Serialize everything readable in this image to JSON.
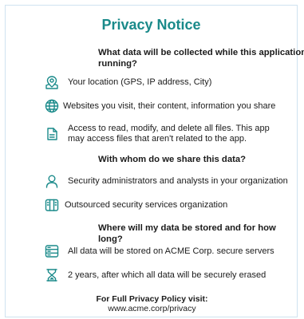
{
  "title": "Privacy Notice",
  "sections": [
    {
      "heading": "What data will be collected while this application is running?",
      "items": [
        {
          "icon": "location-icon",
          "text": "Your location (GPS, IP address, City)"
        },
        {
          "icon": "globe-icon",
          "text": "Websites you visit, their content, information you share"
        },
        {
          "icon": "file-icon",
          "text": "Access to read, modify, and delete all files. This app may access files that aren't related to the app."
        }
      ]
    },
    {
      "heading": "With whom do we share this data?",
      "items": [
        {
          "icon": "person-icon",
          "text": "Security administrators and analysts in your organization"
        },
        {
          "icon": "building-icon",
          "text": "Outsourced security services organization"
        }
      ]
    },
    {
      "heading": "Where will my data be stored and for how long?",
      "items": [
        {
          "icon": "server-icon",
          "text": "All data will be stored on ACME Corp. secure servers"
        },
        {
          "icon": "hourglass-icon",
          "text": "2 years, after which all data will be securely erased"
        }
      ]
    }
  ],
  "footer": {
    "heading": "For Full Privacy Policy visit:",
    "link": "www.acme.corp/privacy"
  },
  "colors": {
    "accent": "#1a8a8a",
    "text": "#1b1b1b",
    "border": "#cfe3f0"
  }
}
